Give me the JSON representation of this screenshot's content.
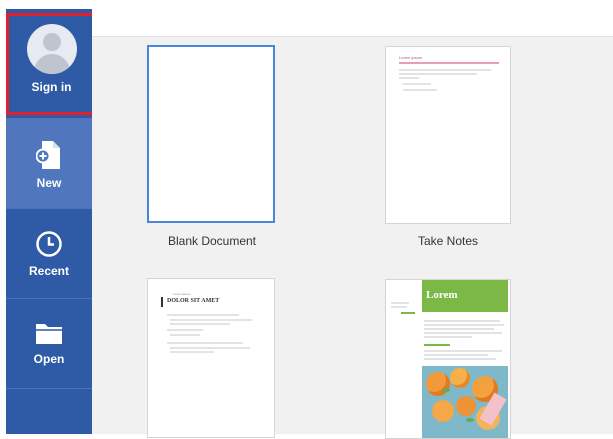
{
  "sidebar": {
    "signin_label": "Sign in",
    "new_label": "New",
    "recent_label": "Recent",
    "open_label": "Open"
  },
  "templates": [
    {
      "label": "Blank Document"
    },
    {
      "label": "Take Notes"
    }
  ],
  "thumb_text": {
    "notes_title": "Lorem ipsum",
    "doc_title": "DOLOR SIT AMET",
    "doc_small": "Lorem ipsum",
    "lorem_heading": "Lorem"
  },
  "colors": {
    "sidebar": "#2e5aa6",
    "sidebar_active": "#5077bd",
    "highlight": "#e2202c",
    "selected_border": "#4a86d8",
    "lorem_green": "#7cb845"
  },
  "icons": {
    "signin": "avatar-icon",
    "new": "new-document-icon",
    "recent": "clock-icon",
    "open": "folder-icon"
  }
}
